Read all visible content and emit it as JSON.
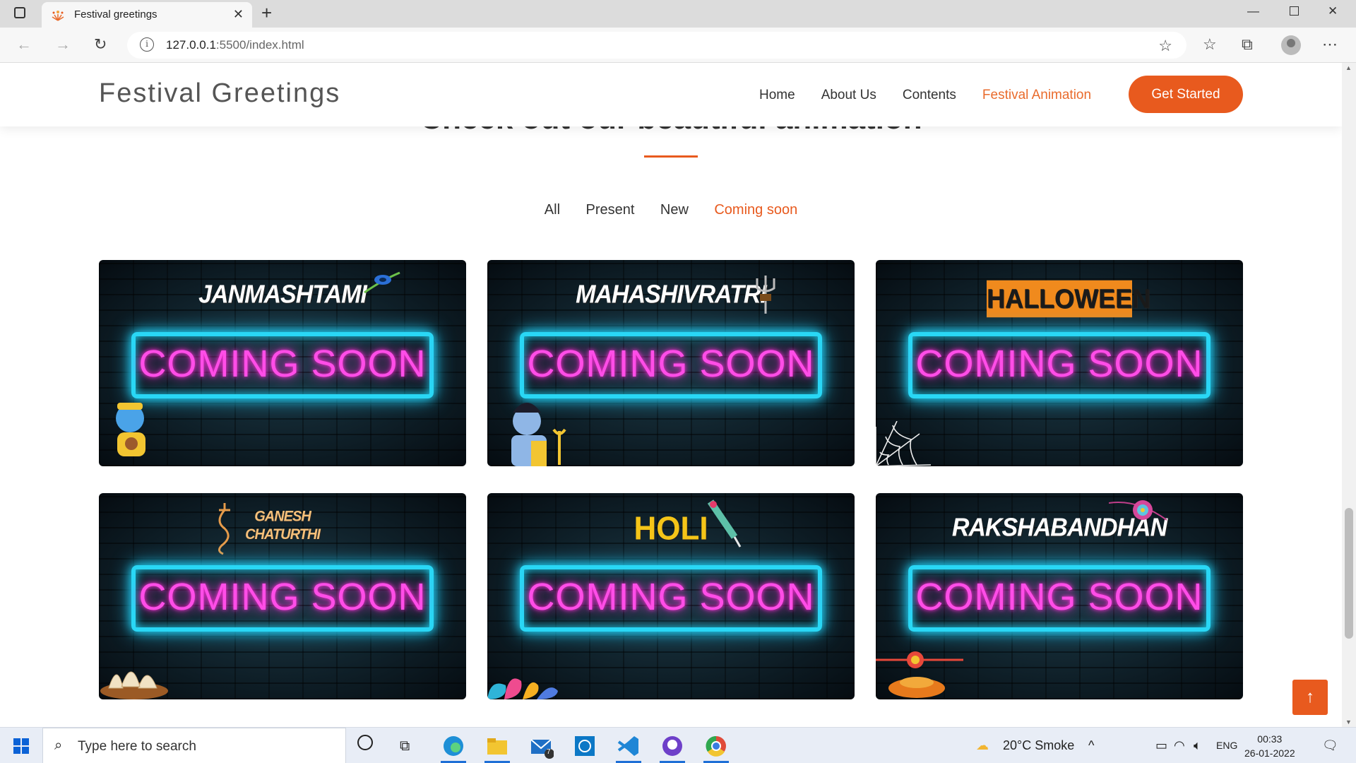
{
  "browser": {
    "tab_title": "Festival greetings",
    "url_host": "127.0.0.1",
    "url_rest": ":5500/index.html"
  },
  "site": {
    "logo": "Festival Greetings",
    "menu": [
      "Home",
      "About Us",
      "Contents",
      "Festival Animation"
    ],
    "active_menu": "Festival Animation",
    "cta": "Get Started",
    "accent_color": "#e85a1e"
  },
  "section": {
    "title": "Check out our beautiful animation",
    "filters": [
      "All",
      "Present",
      "New",
      "Coming soon"
    ],
    "active_filter": "Coming soon"
  },
  "cards": [
    {
      "title": "JANMASHTAMI",
      "banner": "COMING SOON"
    },
    {
      "title": "MAHASHIVRATRI",
      "banner": "COMING SOON"
    },
    {
      "title": "HALLOWEEN",
      "banner": "COMING SOON"
    },
    {
      "title": "GANESH\nCHATURTHI",
      "banner": "COMING SOON"
    },
    {
      "title": "HOLI",
      "banner": "COMING SOON"
    },
    {
      "title": "RAKSHABANDHAN",
      "banner": "COMING SOON"
    }
  ],
  "taskbar": {
    "search_placeholder": "Type here to search",
    "weather": "20°C  Smoke",
    "language": "ENG",
    "time": "00:33",
    "date": "26-01-2022",
    "mail_badge": "7"
  }
}
